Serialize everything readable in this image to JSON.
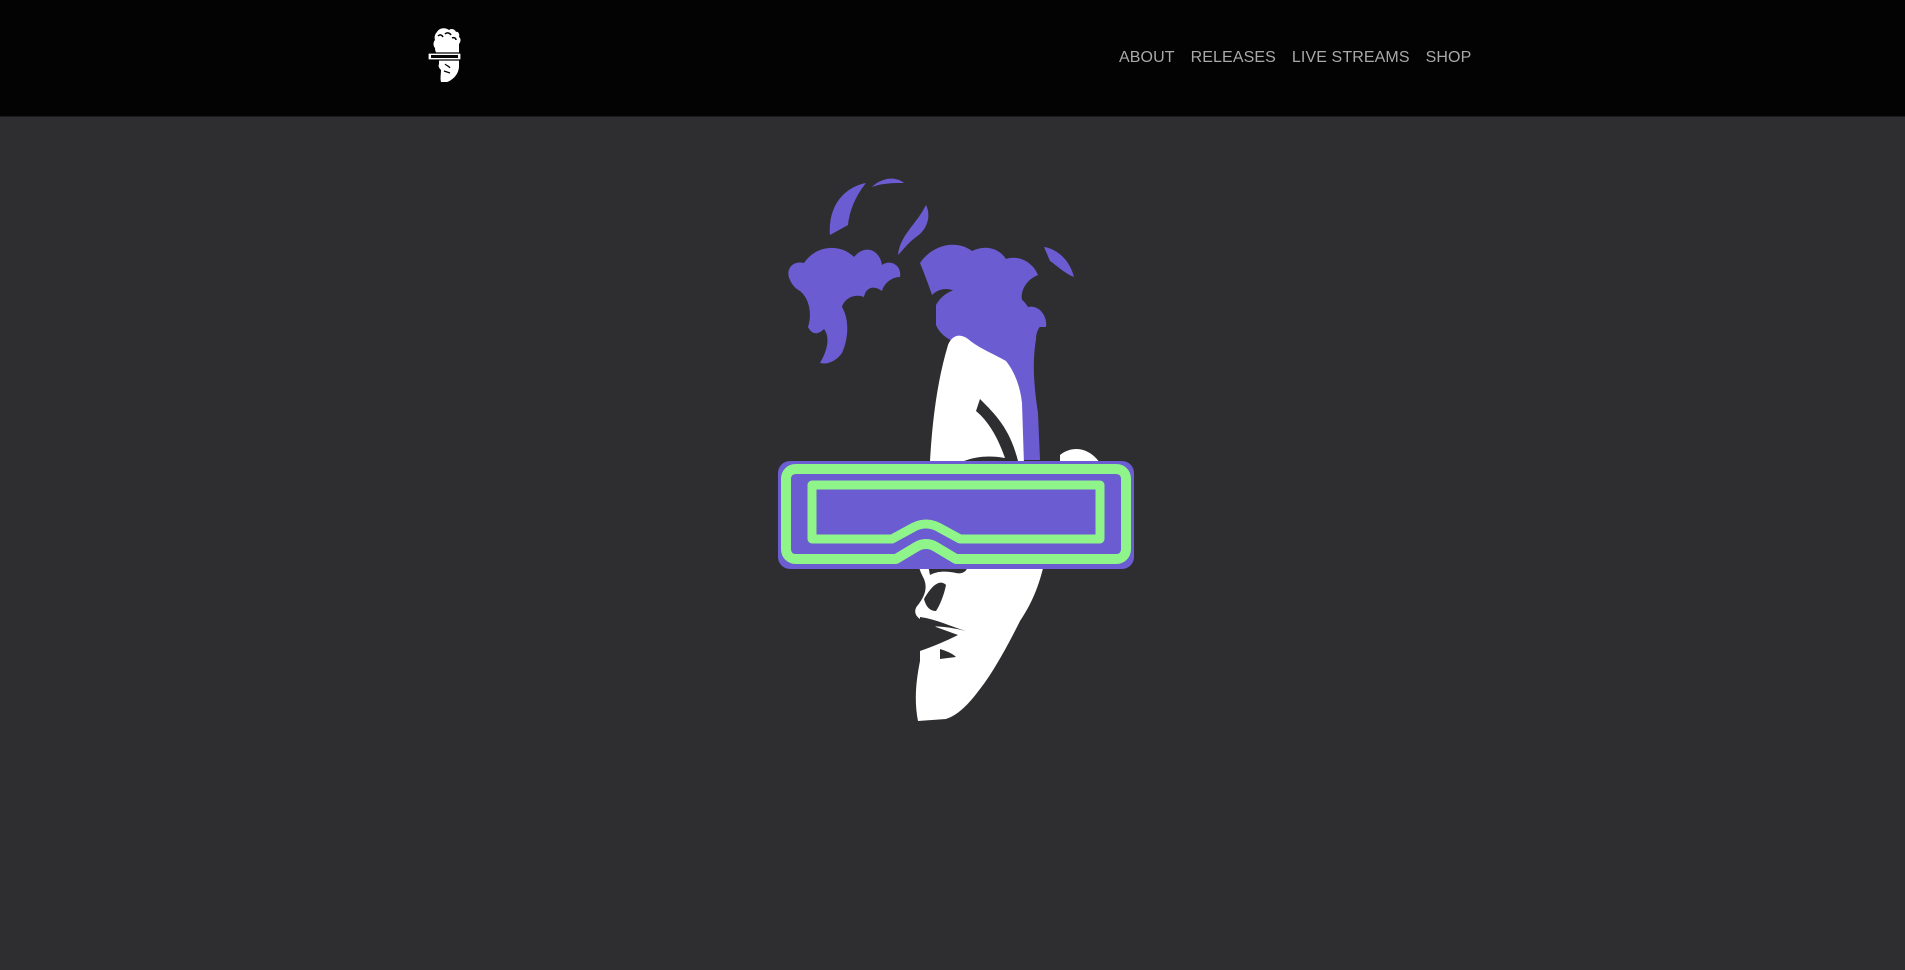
{
  "header": {
    "logo_icon": "face-visor-logo-icon",
    "nav": [
      {
        "label": "ABOUT"
      },
      {
        "label": "RELEASES"
      },
      {
        "label": "LIVE STREAMS"
      },
      {
        "label": "SHOP"
      }
    ]
  },
  "hero": {
    "art_icon": "face-with-visor-illustration",
    "colors": {
      "hair": "#6b5cd2",
      "visor_frame": "#6b5cd2",
      "visor_glow": "#8ff58a",
      "face": "#ffffff",
      "background": "#2e2e30"
    }
  },
  "colors": {
    "topbar": "#030303",
    "nav_text": "#a9a9ab"
  }
}
